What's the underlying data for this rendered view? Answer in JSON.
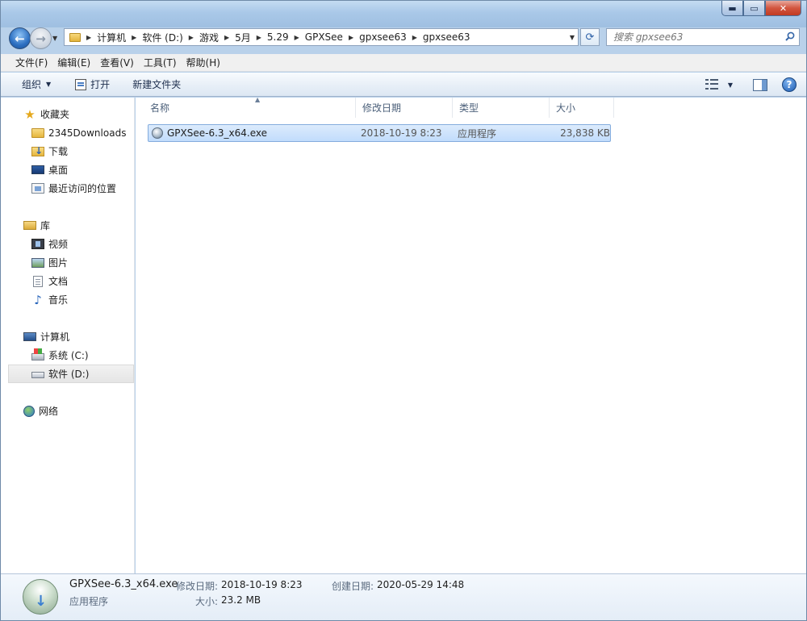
{
  "window": {
    "caption_minimize": "▬",
    "caption_maximize": "▭",
    "caption_close": "✕"
  },
  "nav": {
    "back_icon": "back-arrow-icon",
    "forward_icon": "forward-arrow-icon",
    "breadcrumb": [
      "计算机",
      "软件 (D:)",
      "游戏",
      "5月",
      "5.29",
      "GPXSee",
      "gpxsee63",
      "gpxsee63"
    ],
    "search_placeholder": "搜索 gpxsee63"
  },
  "menubar": {
    "items": [
      "文件(F)",
      "编辑(E)",
      "查看(V)",
      "工具(T)",
      "帮助(H)"
    ]
  },
  "commandbar": {
    "organize": "组织",
    "open": "打开",
    "new_folder": "新建文件夹"
  },
  "sidebar": {
    "favorites": {
      "label": "收藏夹",
      "items": [
        "2345Downloads",
        "下载",
        "桌面",
        "最近访问的位置"
      ]
    },
    "libraries": {
      "label": "库",
      "items": [
        "视频",
        "图片",
        "文档",
        "音乐"
      ]
    },
    "computer": {
      "label": "计算机",
      "items": [
        "系统 (C:)",
        "软件 (D:)"
      ],
      "selected": "软件 (D:)"
    },
    "network": {
      "label": "网络"
    }
  },
  "filelist": {
    "columns": [
      "名称",
      "修改日期",
      "类型",
      "大小"
    ],
    "rows": [
      {
        "name": "GPXSee-6.3_x64.exe",
        "modified": "2018-10-19 8:23",
        "type": "应用程序",
        "size": "23,838 KB",
        "selected": true
      }
    ]
  },
  "details": {
    "filename": "GPXSee-6.3_x64.exe",
    "filetype": "应用程序",
    "modified_label": "修改日期:",
    "modified_value": "2018-10-19 8:23",
    "created_label": "创建日期:",
    "created_value": "2020-05-29 14:48",
    "size_label": "大小:",
    "size_value": "23.2 MB"
  },
  "colors": {
    "selection": "#c1dcfc",
    "accent": "#2c6fc1"
  }
}
